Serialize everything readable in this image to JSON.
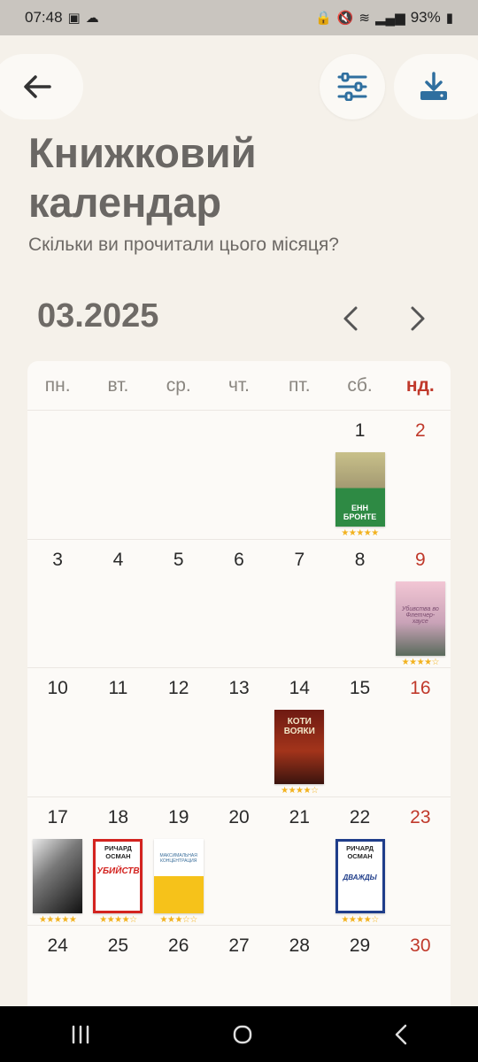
{
  "status": {
    "time": "07:48",
    "battery": "93%"
  },
  "title": "Книжковий календар",
  "subtitle": "Скільки ви прочитали цього місяця?",
  "month": "03.2025",
  "weekdays": [
    "пн.",
    "вт.",
    "ср.",
    "чт.",
    "пт.",
    "сб.",
    "нд."
  ],
  "weeks": [
    [
      "",
      "",
      "",
      "",
      "",
      "1",
      "2"
    ],
    [
      "3",
      "4",
      "5",
      "6",
      "7",
      "8",
      "9"
    ],
    [
      "10",
      "11",
      "12",
      "13",
      "14",
      "15",
      "16"
    ],
    [
      "17",
      "18",
      "19",
      "20",
      "21",
      "22",
      "23"
    ],
    [
      "24",
      "25",
      "26",
      "27",
      "28",
      "29",
      "30"
    ]
  ],
  "books": {
    "d1": {
      "cover_text": "ЕНН БРОНТЕ",
      "rating": 5
    },
    "d9": {
      "cover_text": "Убивства во Флетчер-хаусе",
      "rating": 4
    },
    "d14": {
      "cover_text": "КОТИ ВОЯКИ",
      "rating": 4
    },
    "d17": {
      "cover_text": "",
      "rating": 5
    },
    "d18": {
      "cover_text": "РИЧАРД ОСМАН",
      "cover_sub": "УБИЙСТВ",
      "rating": 4
    },
    "d19": {
      "cover_text": "МАКСИМАЛЬНАЯ КОНЦЕНТРАЦИЯ",
      "rating": 3
    },
    "d22": {
      "cover_text": "РИЧАРД ОСМАН",
      "cover_sub": "ДВАЖДЫ",
      "rating": 4
    }
  },
  "icons": {
    "back": "arrow-left-icon",
    "filter": "sliders-icon",
    "download": "download-icon"
  },
  "colors": {
    "sunday": "#c0392b",
    "accent": "#2f6f9f",
    "star": "#f2b21f"
  }
}
